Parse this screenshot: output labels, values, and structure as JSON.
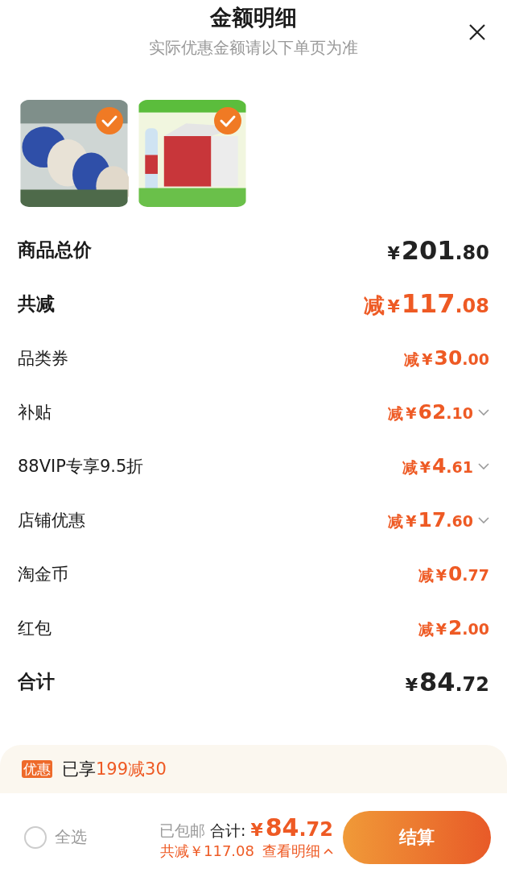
{
  "header": {
    "title": "金额明细",
    "subtitle": "实际优惠金额请以下单页为准"
  },
  "products": [
    {
      "kind": "picture",
      "selected": true
    },
    {
      "kind": "picture",
      "selected": true
    }
  ],
  "rows": [
    {
      "kind": "total",
      "label": "商品总价",
      "prefix": "",
      "currency": "¥",
      "integer": "201",
      "decimal": ".80",
      "expandable": false
    },
    {
      "kind": "discount-total",
      "label": "共减",
      "prefix": "减",
      "currency": "¥",
      "integer": "117",
      "decimal": ".08",
      "expandable": false
    },
    {
      "kind": "discount",
      "label": "品类券",
      "prefix": "减",
      "currency": "¥",
      "integer": "30",
      "decimal": ".00",
      "expandable": false
    },
    {
      "kind": "discount",
      "label": "补贴",
      "prefix": "减",
      "currency": "¥",
      "integer": "62",
      "decimal": ".10",
      "expandable": true
    },
    {
      "kind": "discount",
      "label": "88VIP专享9.5折",
      "prefix": "减",
      "currency": "¥",
      "integer": "4",
      "decimal": ".61",
      "expandable": true
    },
    {
      "kind": "discount",
      "label": "店铺优惠",
      "prefix": "减",
      "currency": "¥",
      "integer": "17",
      "decimal": ".60",
      "expandable": true
    },
    {
      "kind": "discount",
      "label": "淘金币",
      "prefix": "减",
      "currency": "¥",
      "integer": "0",
      "decimal": ".77",
      "expandable": false
    },
    {
      "kind": "discount",
      "label": "红包",
      "prefix": "减",
      "currency": "¥",
      "integer": "2",
      "decimal": ".00",
      "expandable": false
    },
    {
      "kind": "total",
      "label": "合计",
      "prefix": "",
      "currency": "¥",
      "integer": "84",
      "decimal": ".72",
      "expandable": false
    }
  ],
  "promo": {
    "badge": "优惠",
    "text": "已享",
    "highlight": "199减30"
  },
  "footer": {
    "select_all": {
      "label": "全选",
      "checked": false
    },
    "shipping": "已包邮",
    "total_label": "合计:",
    "currency": "¥",
    "integer": "84",
    "decimal": ".72",
    "saved": "共减￥117.08",
    "details_link": "查看明细",
    "checkout": "结算"
  }
}
